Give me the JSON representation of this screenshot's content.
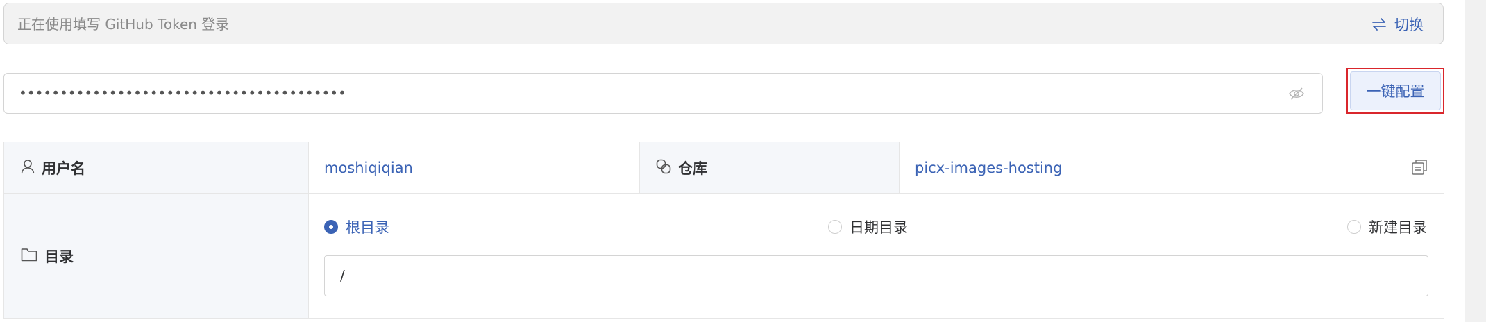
{
  "notice": {
    "text": "正在使用填写 GitHub Token 登录",
    "switch_label": "切换",
    "switch_icon": "swap-arrows-icon"
  },
  "token": {
    "masked_value": "••••••••••••••••••••••••••••••••••••••••",
    "eye_icon": "eye-off-icon",
    "config_label": "一键配置"
  },
  "info": {
    "username_label": "用户名",
    "username_value": "moshiqiqian",
    "repo_label": "仓库",
    "repo_value": "picx-images-hosting",
    "dir_label": "目录",
    "dir_options": [
      {
        "label": "根目录",
        "checked": true
      },
      {
        "label": "日期目录",
        "checked": false
      },
      {
        "label": "新建目录",
        "checked": false
      }
    ],
    "dir_path": "/"
  },
  "colors": {
    "accent": "#3b63b5",
    "highlight_outline": "#d9262c",
    "label_bg": "#f5f7fa"
  }
}
